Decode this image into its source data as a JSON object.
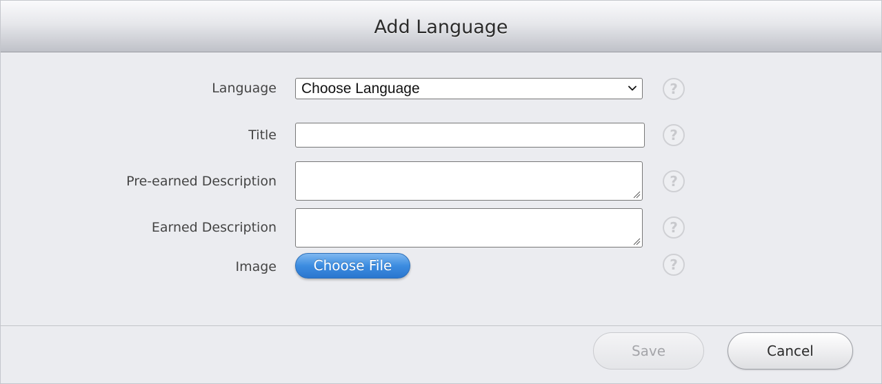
{
  "dialog": {
    "title": "Add Language"
  },
  "form": {
    "language": {
      "label": "Language",
      "selected": "Choose Language"
    },
    "title": {
      "label": "Title",
      "value": ""
    },
    "pre_earned": {
      "label": "Pre-earned Description",
      "value": ""
    },
    "earned": {
      "label": "Earned Description",
      "value": ""
    },
    "image": {
      "label": "Image",
      "button_label": "Choose File"
    },
    "help_glyph": "?"
  },
  "footer": {
    "save_label": "Save",
    "cancel_label": "Cancel",
    "save_enabled": false
  },
  "icons": {
    "help": "question-mark-circle-icon",
    "dropdown": "chevron-down-icon",
    "resize": "resize-handle-icon"
  }
}
